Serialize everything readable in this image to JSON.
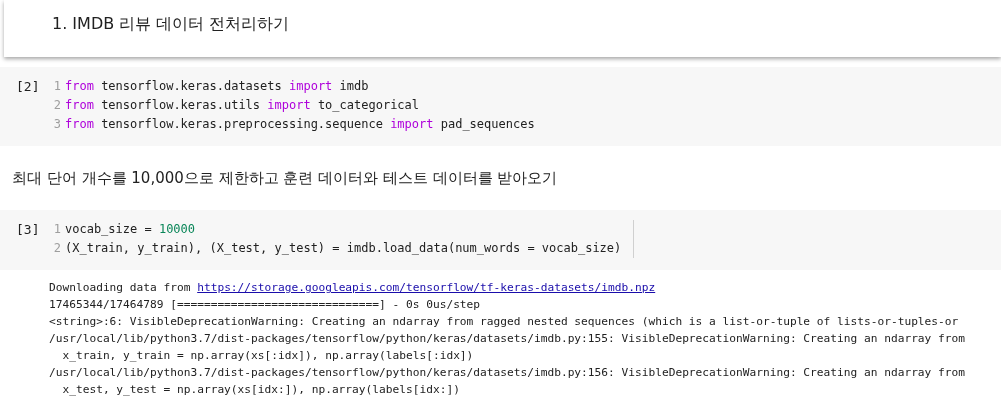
{
  "heading": "1. IMDB 리뷰 데이터 전처리하기",
  "cells": [
    {
      "kind": "code",
      "count": "[2]",
      "lines": [
        {
          "number": "1",
          "tokens": [
            {
              "kind": "keyword",
              "text": "from"
            },
            {
              "kind": "plain",
              "text": " tensorflow.keras.datasets "
            },
            {
              "kind": "keyword",
              "text": "import"
            },
            {
              "kind": "plain",
              "text": " imdb"
            }
          ]
        },
        {
          "number": "2",
          "tokens": [
            {
              "kind": "keyword",
              "text": "from"
            },
            {
              "kind": "plain",
              "text": " tensorflow.keras.utils "
            },
            {
              "kind": "keyword",
              "text": "import"
            },
            {
              "kind": "plain",
              "text": " to_categorical"
            }
          ]
        },
        {
          "number": "3",
          "tokens": [
            {
              "kind": "keyword",
              "text": "from"
            },
            {
              "kind": "plain",
              "text": " tensorflow.keras.preprocessing.sequence "
            },
            {
              "kind": "keyword",
              "text": "import"
            },
            {
              "kind": "plain",
              "text": " pad_sequences"
            }
          ]
        }
      ]
    },
    {
      "kind": "text",
      "text": "최대 단어 개수를 10,000으로 제한하고 훈련 데이터와 테스트 데이터를 받아오기"
    },
    {
      "kind": "code",
      "count": "[3]",
      "lines": [
        {
          "number": "1",
          "tokens": [
            {
              "kind": "plain",
              "text": "vocab_size = "
            },
            {
              "kind": "number",
              "text": "10000"
            }
          ]
        },
        {
          "number": "2",
          "tokens": [
            {
              "kind": "plain",
              "text": "(X_train, y_train), (X_test, y_test) = imdb.load_data(num_words = vocab_size)"
            }
          ]
        }
      ],
      "output": [
        [
          {
            "kind": "plain",
            "text": "Downloading data from "
          },
          {
            "kind": "link",
            "text": "https://storage.googleapis.com/tensorflow/tf-keras-datasets/imdb.npz"
          }
        ],
        [
          {
            "kind": "plain",
            "text": "17465344/17464789 [==============================] - 0s 0us/step"
          }
        ],
        [
          {
            "kind": "plain",
            "text": "<string>:6: VisibleDeprecationWarning: Creating an ndarray from ragged nested sequences (which is a list-or-tuple of lists-or-tuples-or"
          }
        ],
        [
          {
            "kind": "plain",
            "text": "/usr/local/lib/python3.7/dist-packages/tensorflow/python/keras/datasets/imdb.py:155: VisibleDeprecationWarning: Creating an ndarray from"
          }
        ],
        [
          {
            "kind": "plain",
            "text": "  x_train, y_train = np.array(xs[:idx]), np.array(labels[:idx])"
          }
        ],
        [
          {
            "kind": "plain",
            "text": "/usr/local/lib/python3.7/dist-packages/tensorflow/python/keras/datasets/imdb.py:156: VisibleDeprecationWarning: Creating an ndarray from"
          }
        ],
        [
          {
            "kind": "plain",
            "text": "  x_test, y_test = np.array(xs[idx:]), np.array(labels[idx:])"
          }
        ]
      ]
    }
  ]
}
